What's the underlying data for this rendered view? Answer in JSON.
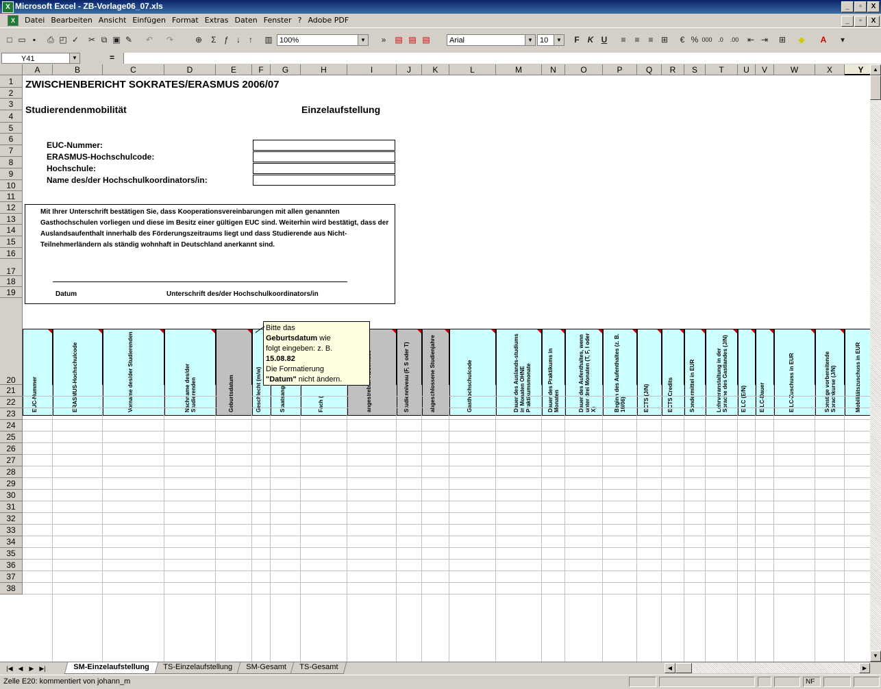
{
  "window": {
    "title": "Microsoft Excel - ZB-Vorlage06_07.xls",
    "app_icon": "excel-icon",
    "btn_min": "_",
    "btn_max": "▫",
    "btn_close": "X"
  },
  "menu": {
    "items": [
      "Datei",
      "Bearbeiten",
      "Ansicht",
      "Einfügen",
      "Format",
      "Extras",
      "Daten",
      "Fenster",
      "?",
      "Adobe PDF"
    ]
  },
  "toolbar": {
    "zoom": "100%",
    "font": "Arial",
    "font_size": "10",
    "bold": "F",
    "italic": "K",
    "underline": "U",
    "percent": "%",
    "thousands": "000"
  },
  "formula": {
    "name_box": "Y41",
    "eq": "=",
    "value": ""
  },
  "columns": [
    "A",
    "B",
    "C",
    "D",
    "E",
    "F",
    "G",
    "H",
    "I",
    "J",
    "K",
    "L",
    "M",
    "N",
    "O",
    "P",
    "Q",
    "R",
    "S",
    "T",
    "U",
    "V",
    "W",
    "X",
    "Y"
  ],
  "rows": [
    "1",
    "2",
    "3",
    "4",
    "5",
    "6",
    "7",
    "8",
    "9",
    "10",
    "11",
    "12",
    "13",
    "14",
    "15",
    "16",
    "17",
    "18",
    "19",
    "20",
    "21",
    "22",
    "23",
    "24",
    "25",
    "26",
    "27",
    "28",
    "29",
    "30",
    "31",
    "32",
    "33",
    "34",
    "35",
    "36",
    "37",
    "38"
  ],
  "sheet": {
    "title": "ZWISCHENBERICHT SOKRATES/ERASMUS 2006/07",
    "subtitle_left": "Studierendenmobilität",
    "subtitle_right": "Einzelaufstellung",
    "fields": [
      "EUC-Nummer:",
      "ERASMUS-Hochschulcode:",
      "Hochschule:",
      "Name des/der Hochschulkoordinators/in:"
    ],
    "declaration": "Mit Ihrer Unterschrift bestätigen Sie, dass Kooperationsvereinbarungen mit allen genannten Gasthochschulen vorliegen und diese im Besitz einer gültigen EUC sind. Weiterhin wird bestätigt, dass der Auslandsaufenthalt innerhalb des Förderungszeitraums liegt und dass Studierende aus Nicht-Teilnehmerländern als ständig wohnhaft in Deutschland anerkannt sind.",
    "datum": "Datum",
    "signature": "Unterschrift des/der Hochschulkoordinators/in"
  },
  "table_headers": [
    "EUC-Nummer",
    "ERASMUS-Hochschulcode",
    "Vorname des/der Studierenden",
    "Nachname des/der Studierenden",
    "Geburtsdatum",
    "Geschlecht (m/w)",
    "Staatsangehörigkeit (Code",
    "Fach (",
    "angestrebter Abschluss",
    "Studienniveau (F, S oder T)",
    "abgeschlossene Studienjahre",
    "Gasthochschulcode",
    "Dauer des Auslands-studiums in Monaten OHNE Praktikumsmonate",
    "Dauer des Praktikums in Monaten",
    "Dauer des Aufenthaltes, wenn unter drei Monaten (T, F, I oder X)",
    "Beginn des Aufenthaltes (z. B. 10/06)",
    "ECTS (J/N)",
    "ECTS Credits",
    "Sondermittel in EUR",
    "Lehrveranstaltung in der Sprache des Gastlandes (J/N)",
    "EILC (E/N)",
    "EILC-Dauer",
    "EILC-Zuschuss in EUR",
    "Sonstige vorbereitende Sprachkurse (J/N)",
    "Mobilitätszuschuss in EUR"
  ],
  "comment": {
    "line1": "Bitte das",
    "line2_bold": "Geburtsdatum",
    "line2_rest": " wie",
    "line3": "folgt eingeben: z. B.",
    "line4_bold": "15.08.82",
    "line5": "Die Formatierung",
    "line6_bold": "\"Datum\"",
    "line6_rest": " nicht ändern."
  },
  "tabs": [
    "SM-Einzelaufstellung",
    "TS-Einzelaufstellung",
    "SM-Gesamt",
    "TS-Gesamt"
  ],
  "status": {
    "text": "Zelle E20: kommentiert von johann_m",
    "nf": "NF"
  }
}
